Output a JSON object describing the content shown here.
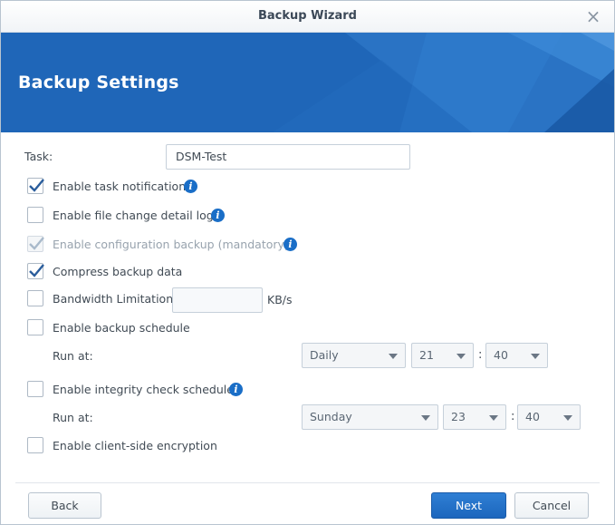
{
  "window": {
    "title": "Backup Wizard"
  },
  "banner": {
    "title": "Backup Settings"
  },
  "task": {
    "label": "Task:",
    "value": "DSM-Test"
  },
  "options": {
    "task_notification": {
      "label": "Enable task notification",
      "checked": true
    },
    "file_change_log": {
      "label": "Enable file change detail log",
      "checked": false
    },
    "config_backup": {
      "label": "Enable configuration backup (mandatory)",
      "checked": true,
      "disabled": true
    },
    "compress": {
      "label": "Compress backup data",
      "checked": true
    },
    "bandwidth": {
      "label": "Bandwidth Limitation",
      "checked": false,
      "value": "",
      "unit": "KB/s"
    },
    "backup_schedule": {
      "label": "Enable backup schedule",
      "checked": false
    },
    "integrity_schedule": {
      "label": "Enable integrity check schedule",
      "checked": false
    },
    "encryption": {
      "label": "Enable client-side encryption",
      "checked": false
    }
  },
  "backup_run": {
    "label": "Run at:",
    "frequency": "Daily",
    "hour": "21",
    "minute": "40",
    "separator": ":"
  },
  "integrity_run": {
    "label": "Run at:",
    "day": "Sunday",
    "hour": "23",
    "minute": "40",
    "separator": ":"
  },
  "buttons": {
    "back": "Back",
    "next": "Next",
    "cancel": "Cancel"
  },
  "colors": {
    "accent": "#1f66b8",
    "primary_button": "#1c66bd",
    "info_icon": "#1a6ec7"
  },
  "icons": {
    "info": "i",
    "close": "×"
  }
}
